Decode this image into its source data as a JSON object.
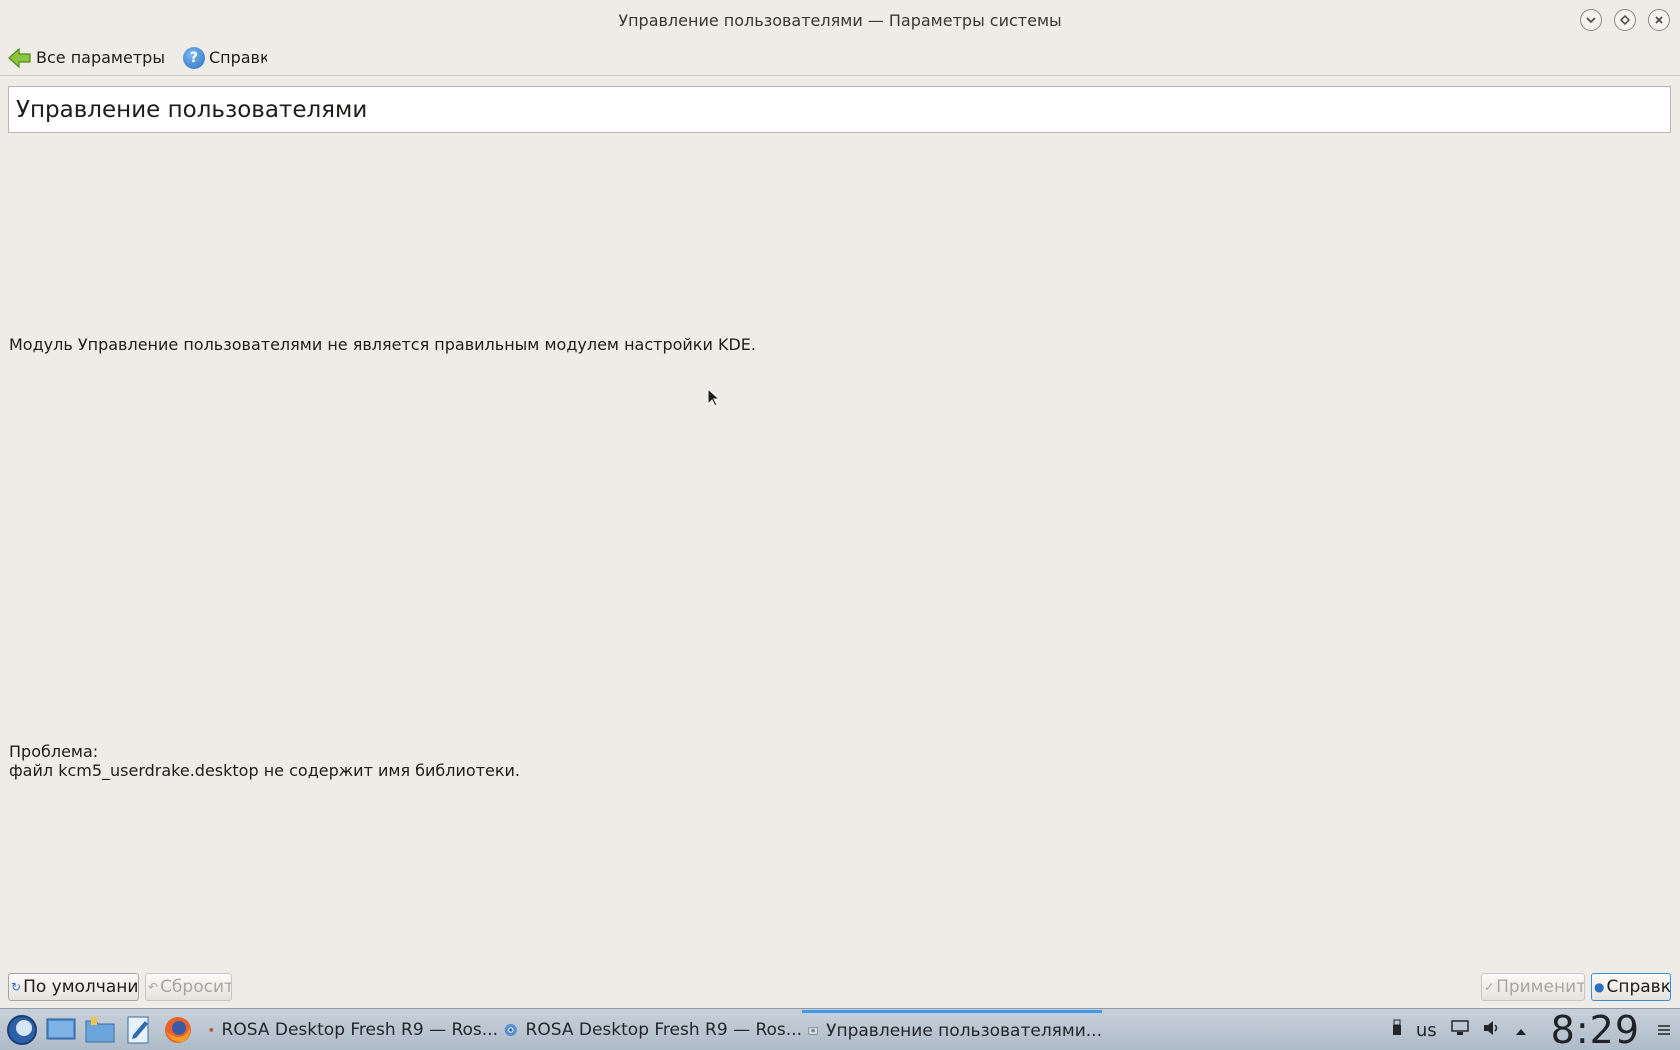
{
  "window": {
    "title": "Управление пользователями — Параметры системы",
    "controls": {
      "minimize": "⌄",
      "maximize": "◇",
      "close": "✕"
    }
  },
  "toolbar": {
    "back_label": "Все параметры",
    "help_label": "Справка",
    "back_icon": "green-left-arrow",
    "help_icon": "blue-question-circle"
  },
  "module": {
    "title": "Управление пользователями",
    "error_message": "Модуль Управление пользователями не является правильным модулем настройки KDE.",
    "problem_heading": "Проблема:",
    "problem_detail": "файл kcm5_userdrake.desktop не содержит имя библиотеки."
  },
  "buttons": {
    "defaults": "По умолчанию",
    "reset": "Сбросить",
    "apply": "Применить",
    "help": "Справка"
  },
  "taskbar": {
    "launchers": [
      "rosa-menu-icon",
      "desktop-icon",
      "file-manager-icon",
      "editor-icon",
      "firefox-icon"
    ],
    "tasks": [
      {
        "label": "ROSA Desktop Fresh R9 — Ros...",
        "icon": "firefox-icon",
        "active": false
      },
      {
        "label": "ROSA Desktop Fresh R9 — Ros...",
        "icon": "chromium-icon",
        "active": false
      },
      {
        "label": "Управление пользователями...",
        "icon": "system-settings-icon",
        "active": true
      }
    ],
    "keyboard_layout": "us",
    "clock": "8:29"
  },
  "colors": {
    "window_bg": "#efebe7",
    "accent": "#3d9be9",
    "taskbar_bg": "#b8c4d0"
  }
}
